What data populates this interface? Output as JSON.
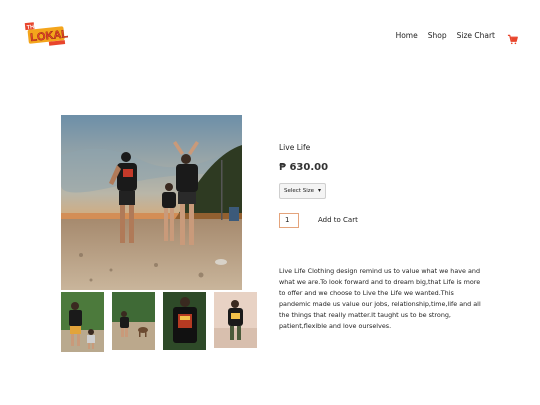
{
  "header": {
    "logo_text": "THE LOKAL",
    "nav": [
      {
        "label": "Home"
      },
      {
        "label": "Shop"
      },
      {
        "label": "Size Chart"
      }
    ],
    "cart_icon": "cart-icon",
    "accent_color": "#e8452c"
  },
  "product": {
    "title": "Live Life",
    "price": "₱ 630.00",
    "select_placeholder": "Select Size",
    "quantity": "1",
    "add_to_cart_label": "Add to Cart",
    "description": "Live Life Clothing design remind us to value what we have and what we are.To look forward and to dream big,that Life is more to offer and we choose to Live the Life we wanted.This pandemic made us value our jobs, relationship,time,life and all the things that really matter.It taught us to be strong, patient,flexible and love ourselves."
  }
}
